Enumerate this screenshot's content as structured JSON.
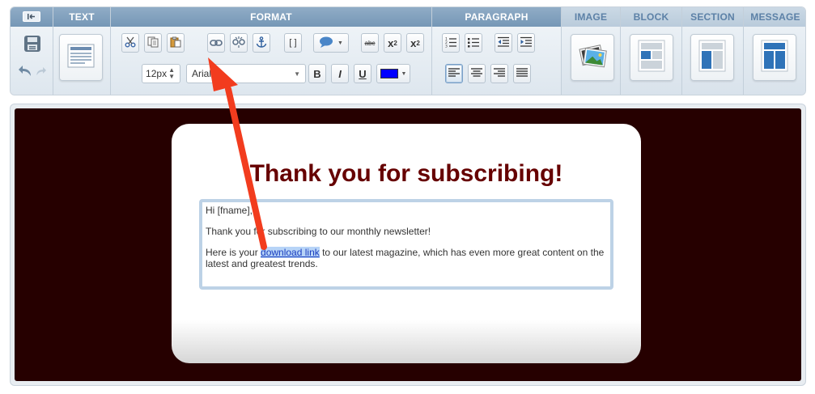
{
  "toolbar": {
    "groups": {
      "text": "TEXT",
      "format": "FORMAT",
      "paragraph": "PARAGRAPH",
      "image": "IMAGE",
      "block": "BLOCK",
      "section": "SECTION",
      "message": "MESSAGE"
    },
    "font_size": "12px",
    "font_family": "Arial",
    "bold_label": "B",
    "italic_label": "I",
    "underline_label": "U",
    "brackets_label": "[ ]",
    "strike_label": "abc",
    "subscript_label": "x",
    "superscript_label": "x",
    "font_color": "#0000ff"
  },
  "editor": {
    "headline": "Thank you for subscribing!",
    "greeting": "Hi [fname],",
    "line1": "Thank you for subscribing to our monthly newsletter!",
    "line2_before": "Here is your ",
    "line2_link": "download link",
    "line2_after": " to our latest magazine, which has even more great content on the latest and greatest trends."
  },
  "colors": {
    "canvas_bg": "#260000",
    "headline": "#660000",
    "toolbar_header": "#7597b6",
    "annotation_arrow": "#f23c1e"
  }
}
